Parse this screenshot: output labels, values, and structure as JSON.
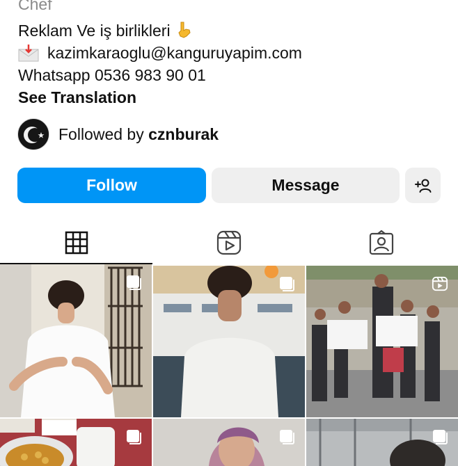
{
  "bio": {
    "category": "Chef",
    "line1": "Reklam Ve iş birlikleri",
    "email": "kazimkaraoglu@kanguruyapim.com",
    "whatsapp": "Whatsapp 0536 983 90 01",
    "translate": "See Translation"
  },
  "followed": {
    "prefix": "Followed by",
    "user": "cznburak"
  },
  "actions": {
    "follow_label": "Follow",
    "message_label": "Message"
  },
  "tabs": [
    {
      "name": "posts",
      "icon": "grid-icon",
      "active": true
    },
    {
      "name": "reels",
      "icon": "reels-icon",
      "active": false
    },
    {
      "name": "tagged",
      "icon": "tagged-icon",
      "active": false
    }
  ],
  "colors": {
    "follow_blue": "#0095f6",
    "secondary_button": "#efefef",
    "muted_text": "#8a8a8a"
  },
  "grid": {
    "posts": [
      {
        "id": "post-1",
        "type": "carousel",
        "icon": "multiple-photos-icon"
      },
      {
        "id": "post-2",
        "type": "carousel",
        "icon": "multiple-photos-icon"
      },
      {
        "id": "post-3",
        "type": "reel",
        "icon": "reels-icon"
      },
      {
        "id": "post-4",
        "type": "carousel",
        "icon": "multiple-photos-icon"
      },
      {
        "id": "post-5",
        "type": "carousel",
        "icon": "multiple-photos-icon"
      },
      {
        "id": "post-6",
        "type": "carousel",
        "icon": "multiple-photos-icon"
      }
    ]
  }
}
